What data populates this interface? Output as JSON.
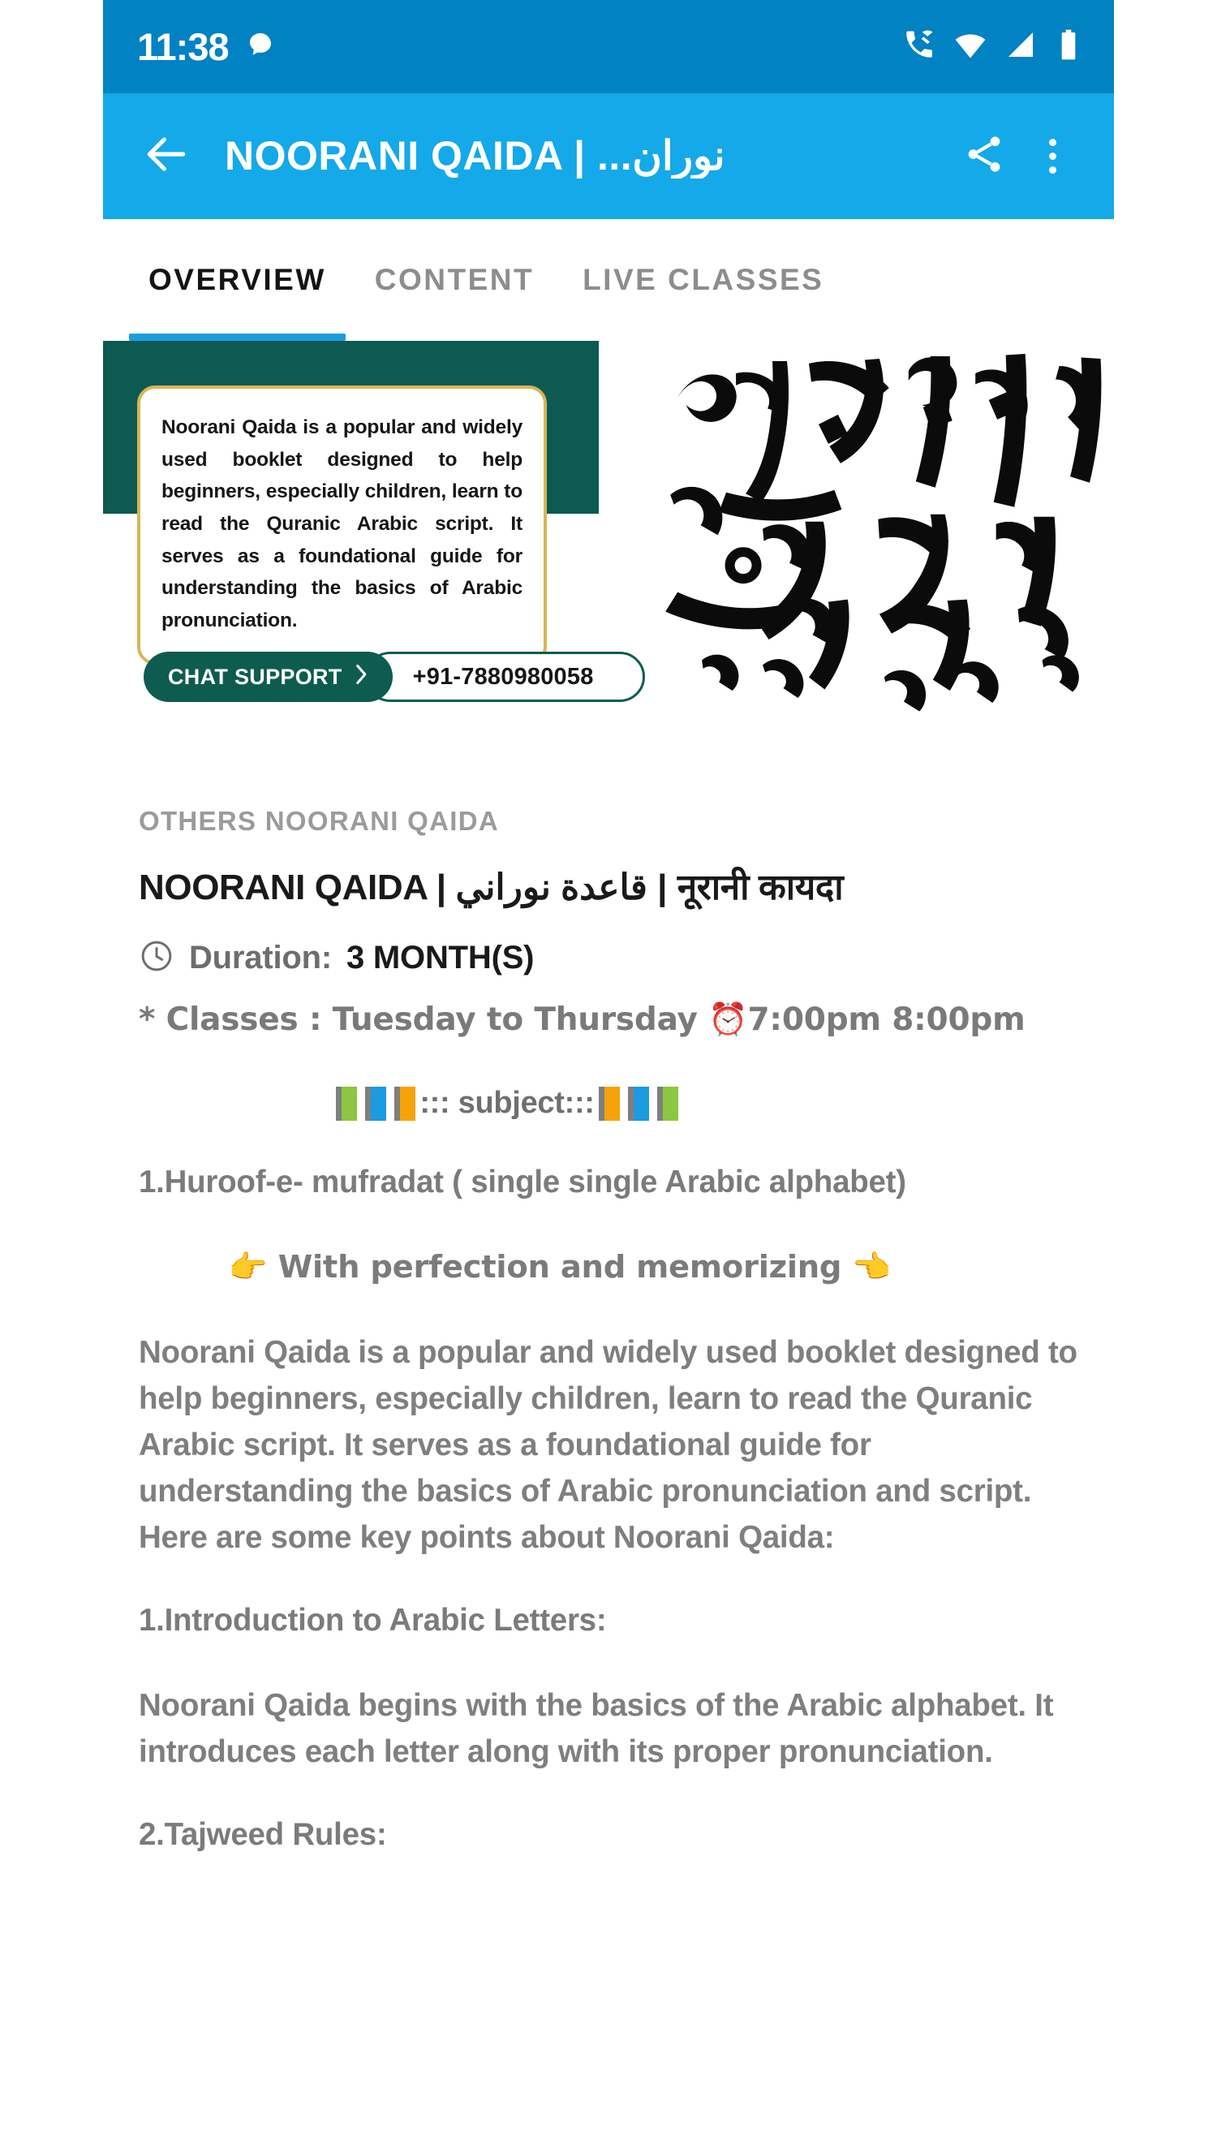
{
  "status_bar": {
    "time": "11:38",
    "icons": [
      "chat-bubble-icon",
      "vowifi-call-icon",
      "wifi-icon",
      "cellular-signal-icon",
      "battery-icon"
    ]
  },
  "app_bar": {
    "back_icon": "back-arrow-icon",
    "title": "NOORANI QAIDA | ...نوران",
    "share_icon": "share-icon",
    "menu_icon": "more-vertical-icon"
  },
  "tabs": [
    {
      "label": "OVERVIEW",
      "active": true
    },
    {
      "label": "CONTENT",
      "active": false
    },
    {
      "label": "LIVE CLASSES",
      "active": false
    }
  ],
  "banner": {
    "card_text": "Noorani Qaida is a popular and widely used booklet designed to help beginners, especially children, learn to read the Quranic Arabic script. It serves as a foundational guide for understanding the basics of Arabic pronunciation.",
    "chat_support_label": "CHAT SUPPORT",
    "chat_chevron": "chevron-right-icon",
    "phone_number": "+91-7880980058",
    "logo": "arabic-calligraphy-logo"
  },
  "overview": {
    "category": "OTHERS NOORANI QAIDA",
    "title": "NOORANI QAIDA | قاعدة نوراني | नूरानी कायदा",
    "duration_icon": "clock-icon",
    "duration_label": "Duration:",
    "duration_value": "3 MONTH(S)",
    "classes_line": "* Classes  :  Tuesday to Thursday   ⏰7:00pm 8:00pm",
    "subject_heading": "::: subject:::",
    "point_1": "1.Huroof-e- mufradat ( single single  Arabic alphabet)",
    "perfection_line": "👉 With perfection and memorizing 👈",
    "description": "Noorani Qaida is a popular and widely used booklet designed to help beginners, especially children, learn to read the Quranic Arabic script. It serves as a foundational guide for understanding the basics of Arabic pronunciation and script. Here are some key points about Noorani Qaida:",
    "section_1_heading": "1.Introduction to Arabic Letters:",
    "section_1_body": "Noorani Qaida begins with the basics of the Arabic alphabet. It introduces each letter along with its proper pronunciation.",
    "section_2_heading": "2.Tajweed Rules:"
  },
  "colors": {
    "status_bar_blue": "#0082c3",
    "app_bar_blue": "#14a9e8",
    "tab_indicator_blue": "#1b9fe0",
    "banner_teal": "#0c5a52",
    "banner_gold": "#dfb349",
    "chat_pill_green": "#0d5c4f"
  }
}
